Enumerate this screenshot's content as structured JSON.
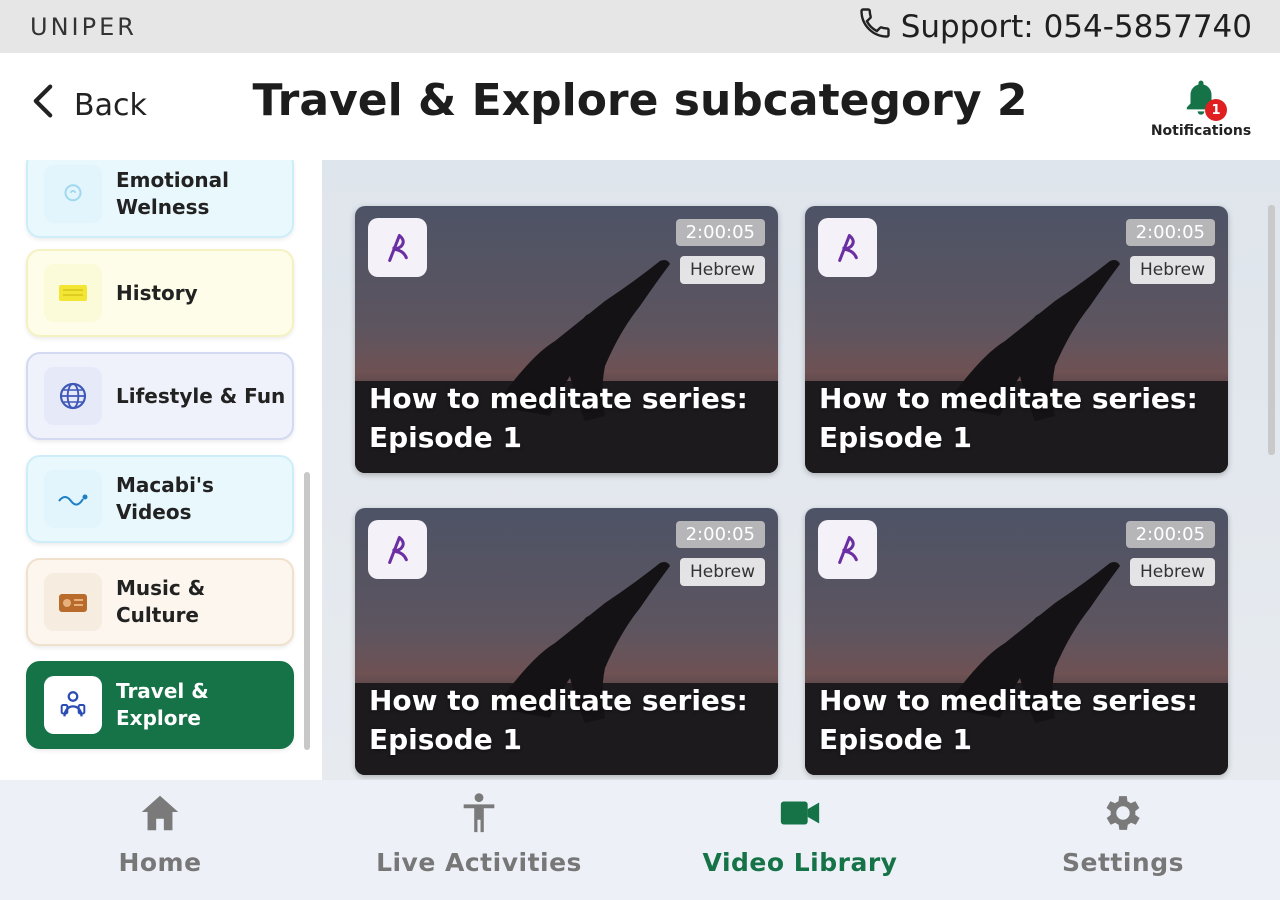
{
  "topbar": {
    "brand": "UNIPER",
    "support": "Support: 054-5857740"
  },
  "header": {
    "back_label": "Back",
    "title": "Travel & Explore subcategory 2",
    "notifications_label": "Notifications",
    "notifications_count": "1"
  },
  "sidebar": {
    "items": [
      {
        "label": "Emotional\nWelness",
        "icon": "mind-icon",
        "color": "#e8f7fd"
      },
      {
        "label": "History",
        "icon": "scroll-icon",
        "color": "#fefde8"
      },
      {
        "label": "Lifestyle & Fun",
        "icon": "globe-icon",
        "color": "#eef1fb"
      },
      {
        "label": "Macabi's Videos",
        "icon": "macabi-logo-icon",
        "color": "#e8f7fd"
      },
      {
        "label": "Music & Culture",
        "icon": "radio-icon",
        "color": "#fbf6ef"
      },
      {
        "label": "Travel &\nExplore",
        "icon": "traveler-icon",
        "color": "#157347",
        "selected": true
      }
    ]
  },
  "videos": [
    {
      "title": "How to meditate series: Episode 1",
      "duration": "2:00:05",
      "language": "Hebrew"
    },
    {
      "title": "How to meditate series: Episode 1",
      "duration": "2:00:05",
      "language": "Hebrew"
    },
    {
      "title": "How to meditate series: Episode 1",
      "duration": "2:00:05",
      "language": "Hebrew"
    },
    {
      "title": "How to meditate series: Episode 1",
      "duration": "2:00:05",
      "language": "Hebrew"
    }
  ],
  "bottom_nav": {
    "items": [
      {
        "label": "Home",
        "icon": "home-icon",
        "active": false
      },
      {
        "label": "Live Activities",
        "icon": "person-icon",
        "active": false
      },
      {
        "label": "Video Library",
        "icon": "video-camera-icon",
        "active": true
      },
      {
        "label": "Settings",
        "icon": "gear-icon",
        "active": false
      }
    ]
  },
  "colors": {
    "accent": "#157347",
    "inactive": "#777777",
    "badge": "#e02020"
  }
}
